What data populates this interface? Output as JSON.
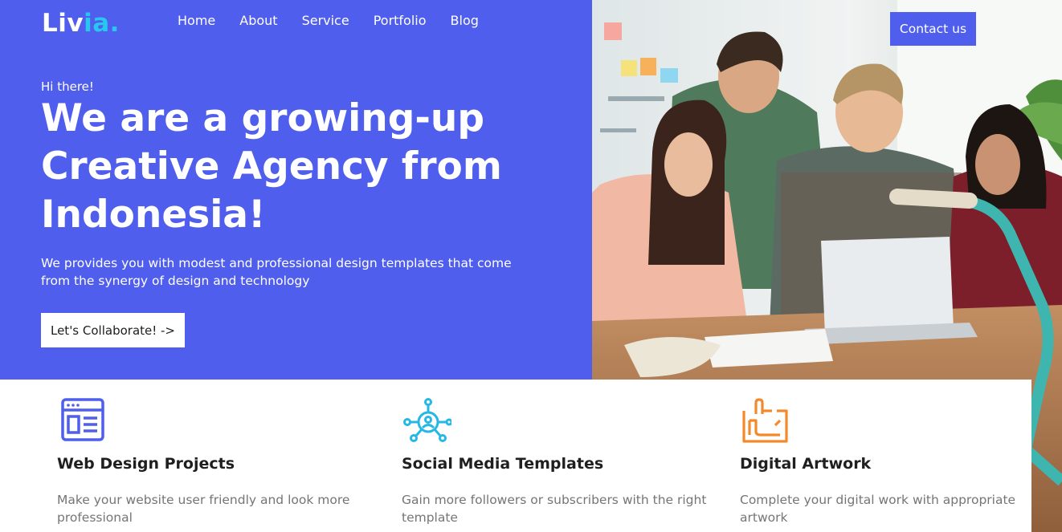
{
  "brand": {
    "name_part1": "Liv",
    "name_part2": "ia",
    "dot": ".",
    "accent_color": "#29c7ef"
  },
  "nav": {
    "items": [
      "Home",
      "About",
      "Service",
      "Portfolio",
      "Blog"
    ]
  },
  "header": {
    "contact_label": "Contact us"
  },
  "hero": {
    "eyebrow": "Hi there!",
    "headline": "We are a growing-up Creative Agency from Indonesia!",
    "description": "We provides you with modest and professional design templates that come from the synergy of design and technology",
    "cta_label": "Let's Collaborate! ->",
    "background_color": "#4f5eec"
  },
  "services": [
    {
      "icon": "browser-layout-icon",
      "icon_color": "#4f5eec",
      "title": "Web Design Projects",
      "description": "Make your website user friendly and look more professional"
    },
    {
      "icon": "network-user-icon",
      "icon_color": "#25b8e6",
      "title": "Social Media Templates",
      "description": "Gain more followers or subscribers with the right template"
    },
    {
      "icon": "document-pen-icon",
      "icon_color": "#f28a2c",
      "title": "Digital Artwork",
      "description": "Complete your digital work with appropriate artwork"
    }
  ]
}
